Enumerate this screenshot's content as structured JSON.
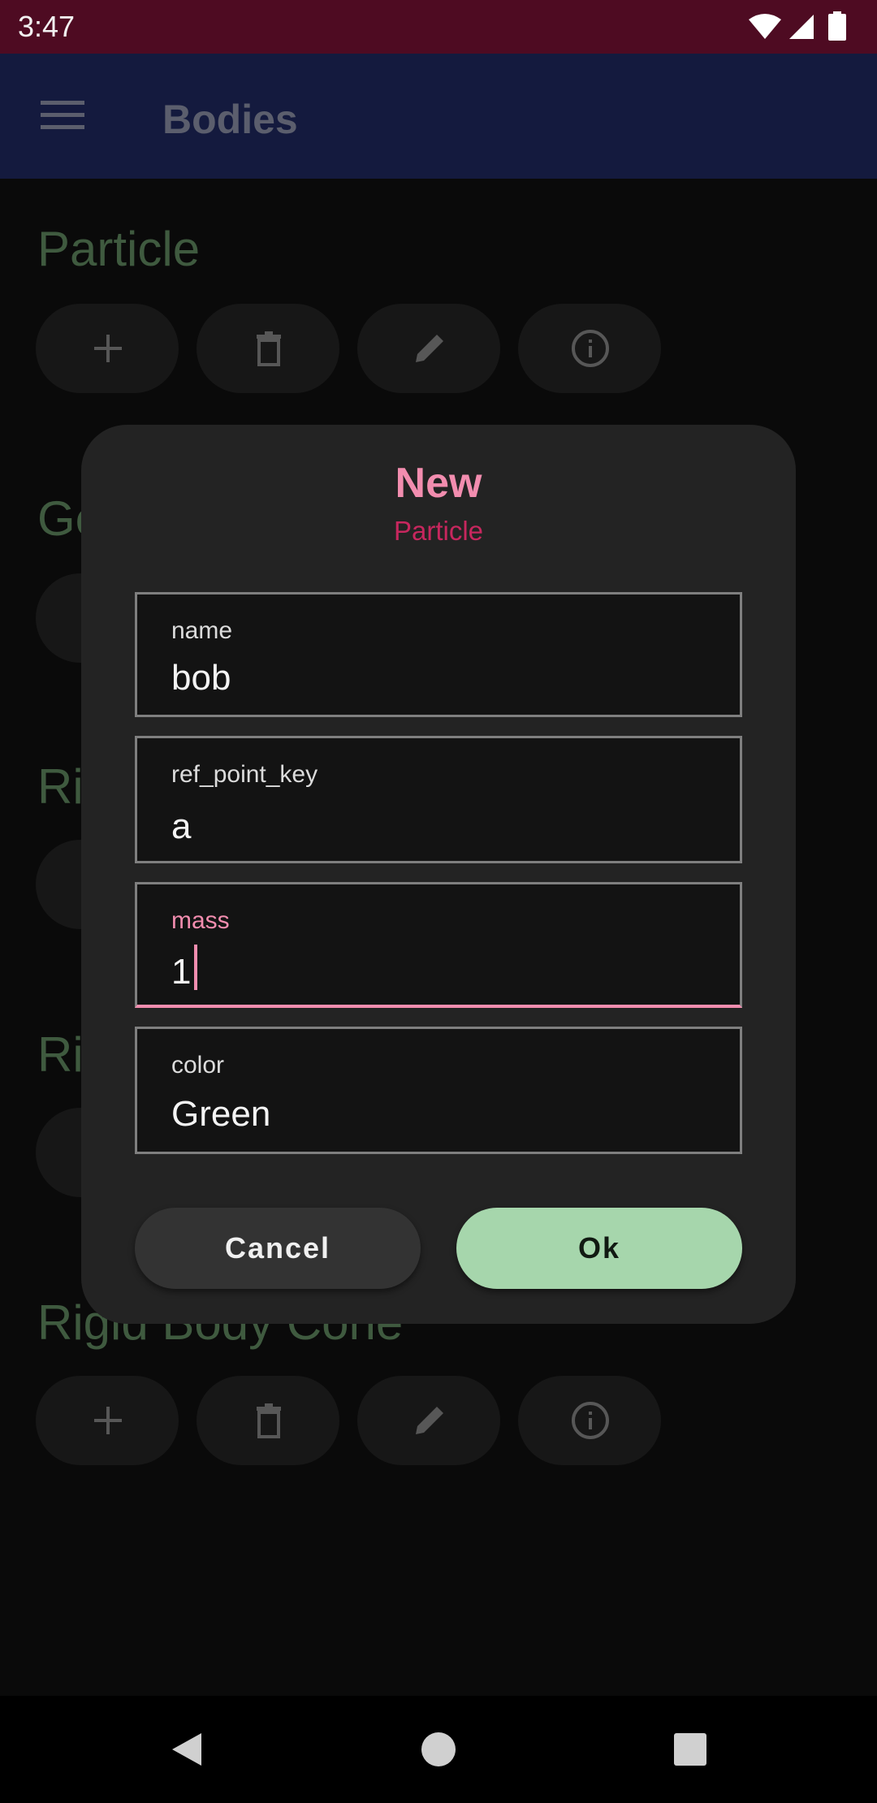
{
  "status_bar": {
    "time": "3:47"
  },
  "app_bar": {
    "title": "Bodies"
  },
  "sections": [
    {
      "title": "Particle"
    },
    {
      "title": "Ge"
    },
    {
      "title": "Ri"
    },
    {
      "title": "Ri"
    },
    {
      "title": "Rigid Body Cone"
    }
  ],
  "dialog": {
    "title": "New",
    "subtitle": "Particle",
    "fields": [
      {
        "label": "name",
        "value": "bob"
      },
      {
        "label": "ref_point_key",
        "value": "a"
      },
      {
        "label": "mass",
        "value": "1"
      },
      {
        "label": "color",
        "value": "Green"
      }
    ],
    "cancel_label": "Cancel",
    "ok_label": "Ok"
  },
  "colors": {
    "accent": "#f28daf",
    "subtitle": "#c7275e",
    "ok_button": "#a6d6ac",
    "status_bar": "#4e0b22",
    "app_bar": "#141a3e"
  },
  "icons": [
    "menu-icon",
    "add-icon",
    "delete-icon",
    "edit-icon",
    "info-icon",
    "back-icon",
    "home-icon",
    "recents-icon",
    "wifi-icon",
    "signal-icon",
    "battery-icon"
  ]
}
